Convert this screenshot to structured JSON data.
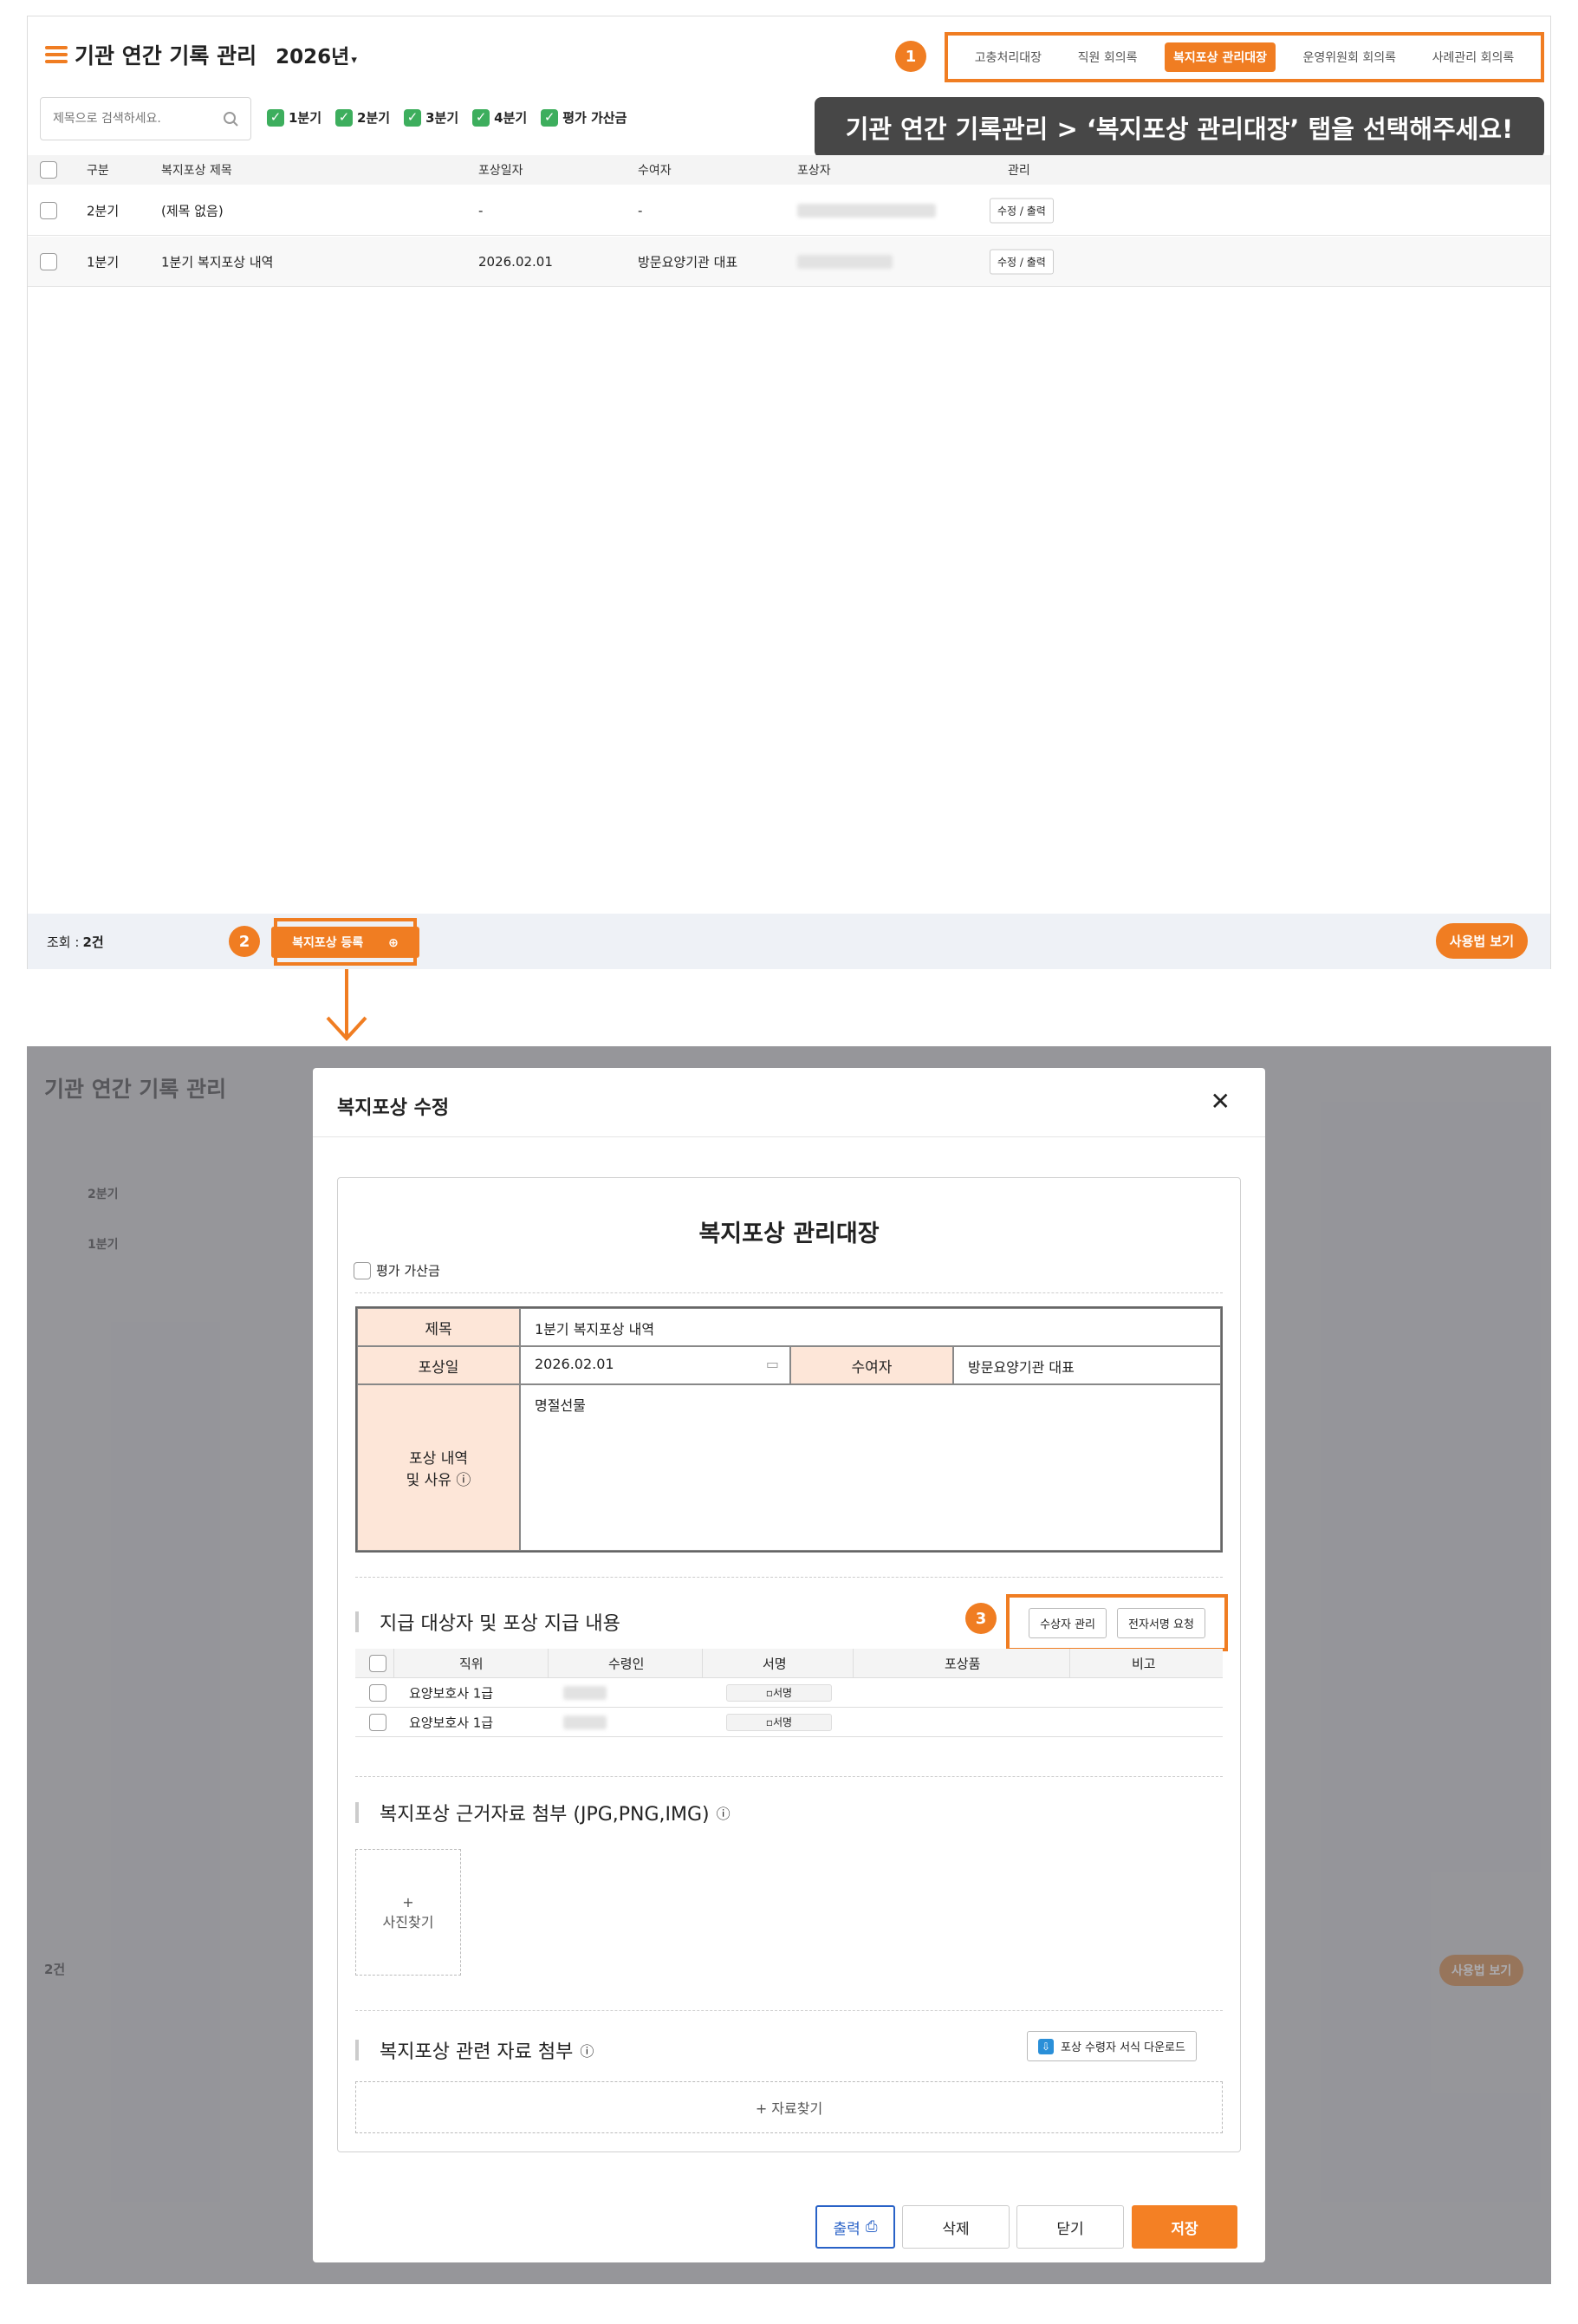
{
  "header": {
    "title": "기관 연간 기록 관리",
    "year": "2026년"
  },
  "tabs": [
    "고충처리대장",
    "직원 회의록",
    "복지포상 관리대장",
    "운영위원회 회의록",
    "사례관리 회의록"
  ],
  "active_tab": "복지포상 관리대장",
  "badges": [
    "1",
    "2",
    "3"
  ],
  "search": {
    "placeholder": "제목으로 검색하세요."
  },
  "filters": [
    "1분기",
    "2분기",
    "3분기",
    "4분기",
    "평가 가산금"
  ],
  "tooltip": "기관 연간 기록관리 > ‘복지포상 관리대장’ 탭을 선택해주세요!",
  "columns": [
    "구분",
    "복지포상 제목",
    "포상일자",
    "수여자",
    "포상자",
    "관리"
  ],
  "rows": [
    {
      "quarter": "2분기",
      "title": "(제목 없음)",
      "date": "-",
      "giver": "-",
      "action": "수정 / 출력"
    },
    {
      "quarter": "1분기",
      "title": "1분기 복지포상 내역",
      "date": "2026.02.01",
      "giver": "방문요양기관 대표",
      "action": "수정 / 출력"
    }
  ],
  "footer": {
    "count_label": "조회 :",
    "count": "2건",
    "register": "복지포상 등록",
    "help": "사용법 보기"
  },
  "modal": {
    "title": "복지포상 수정",
    "doc_title": "복지포상 관리대장",
    "bonus_label": "평가 가산금",
    "form": {
      "title_label": "제목",
      "title_value": "1분기 복지포상 내역",
      "date_label": "포상일",
      "date_value": "2026.02.01",
      "giver_label": "수여자",
      "giver_value": "방문요양기관 대표",
      "reason_label_1": "포상 내역",
      "reason_label_2": "및 사유",
      "reason_value": "명절선물"
    },
    "section1": "지급 대상자 및 포상 지급 내용",
    "recipient_btn": "수상자 관리",
    "esign_btn": "전자서명 요청",
    "grid_cols": [
      "직위",
      "수령인",
      "서명",
      "포상품",
      "비고"
    ],
    "grid_rows": [
      {
        "position": "요양보호사 1급",
        "sign": "서명"
      },
      {
        "position": "요양보호사 1급",
        "sign": "서명"
      }
    ],
    "section2": "복지포상 근거자료 첨부 (JPG,PNG,IMG)",
    "photo_find": "사진찾기",
    "section3": "복지포상 관련 자료 첨부",
    "download_btn": "포상 수령자 서식 다운로드",
    "file_find": "+ 자료찾기",
    "buttons": {
      "print": "출력",
      "delete": "삭제",
      "close": "닫기",
      "save": "저장"
    }
  },
  "colors": {
    "accent": "#f07d22",
    "check": "#3dae5d",
    "label_bg": "#fde6d8"
  }
}
